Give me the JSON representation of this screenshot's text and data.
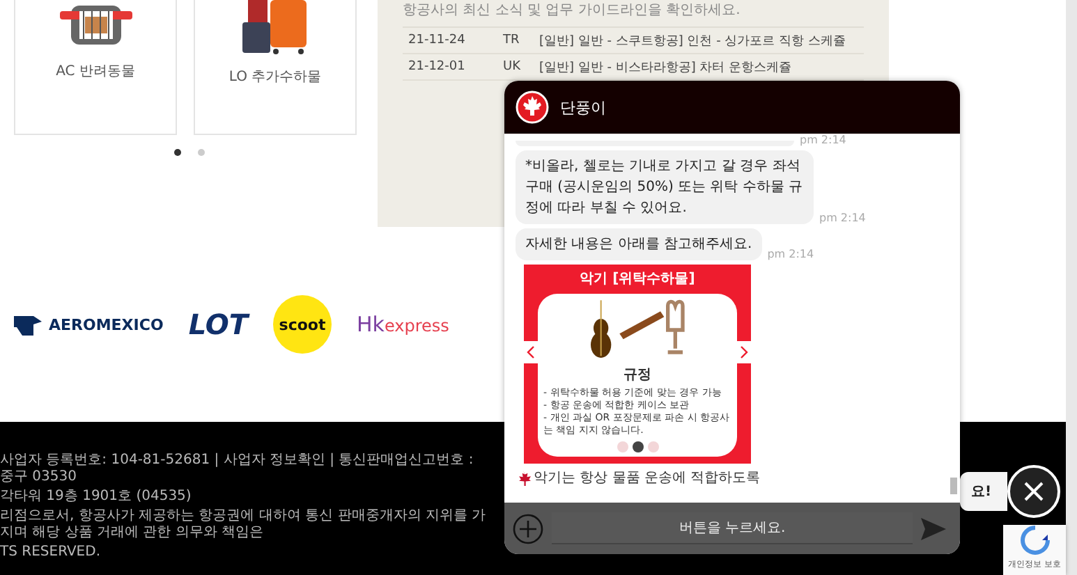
{
  "cards": [
    {
      "kind": "pet",
      "label": "AC 반려동물"
    },
    {
      "kind": "luggage",
      "label": "LO 추가수하물"
    }
  ],
  "card_pager": [
    {
      "selected": true
    },
    {
      "selected": false
    }
  ],
  "notices": {
    "intro": "항공사의 최신 소식 및 업무 가이드라인을 확인하세요.",
    "rows": [
      {
        "date": "21-11-24",
        "code": "TR",
        "title": "[일반] 일반 - 스쿠트항공] 인천 - 싱가포르 직항 스케쥴"
      },
      {
        "date": "21-12-01",
        "code": "UK",
        "title": "[일반] 일반 - 비스타라항공] 차터 운항스케쥴"
      }
    ]
  },
  "logos": [
    {
      "kind": "aeromexico",
      "text": "AEROMEXICO"
    },
    {
      "kind": "lot",
      "text": "LOT"
    },
    {
      "kind": "scoot",
      "text": "scoot"
    },
    {
      "kind": "hk",
      "prefix": "Hk",
      "text": "express"
    }
  ],
  "footer": [
    "사업자 등록번호: 104-81-52681  |  사업자 정보확인  |  통신판매업신고번호 : 중구 03530",
    "각타워 19층 1901호 (04535)",
    "리점으로서, 항공사가 제공하는 항공권에 대하여 통신 판매중개자의 지위를 가지며 해당 상품 거래에 관한 의무와 책임은",
    "TS RESERVED."
  ],
  "chat": {
    "title": "단풍이",
    "messages": [
      {
        "kind": "cut",
        "time": "pm 2:14"
      },
      {
        "kind": "text",
        "text": "*비올라, 첼로는 기내로 가지고 갈 경우 좌석 구매 (공시운임의 50%) 또는 위탁 수하물 규정에 따라 부칠 수 있어요.",
        "time": "pm 2:14"
      },
      {
        "kind": "text",
        "text": "자세한 내용은 아래를 참고해주세요.",
        "time": "pm 2:14"
      },
      {
        "kind": "card",
        "title": "악기 [위탁수하물]",
        "heading": "규정",
        "lines": [
          "- 위탁수하물 허용 기준에 맞는 경우 가능",
          "- 항공 운송에 적합한 케이스 보관",
          "- 개인 과실 OR 포장문제로 파손 시 항공사는 책임 지지 않습니다."
        ],
        "dots": [
          {
            "selected": false
          },
          {
            "selected": true
          },
          {
            "selected": false
          }
        ]
      },
      {
        "kind": "note",
        "text": "악기는 항상 물품 운송에 적합하도록"
      }
    ],
    "input_placeholder": "버튼을 누르세요."
  },
  "side_bubble": "요!",
  "recaptcha": "개인정보 보호"
}
